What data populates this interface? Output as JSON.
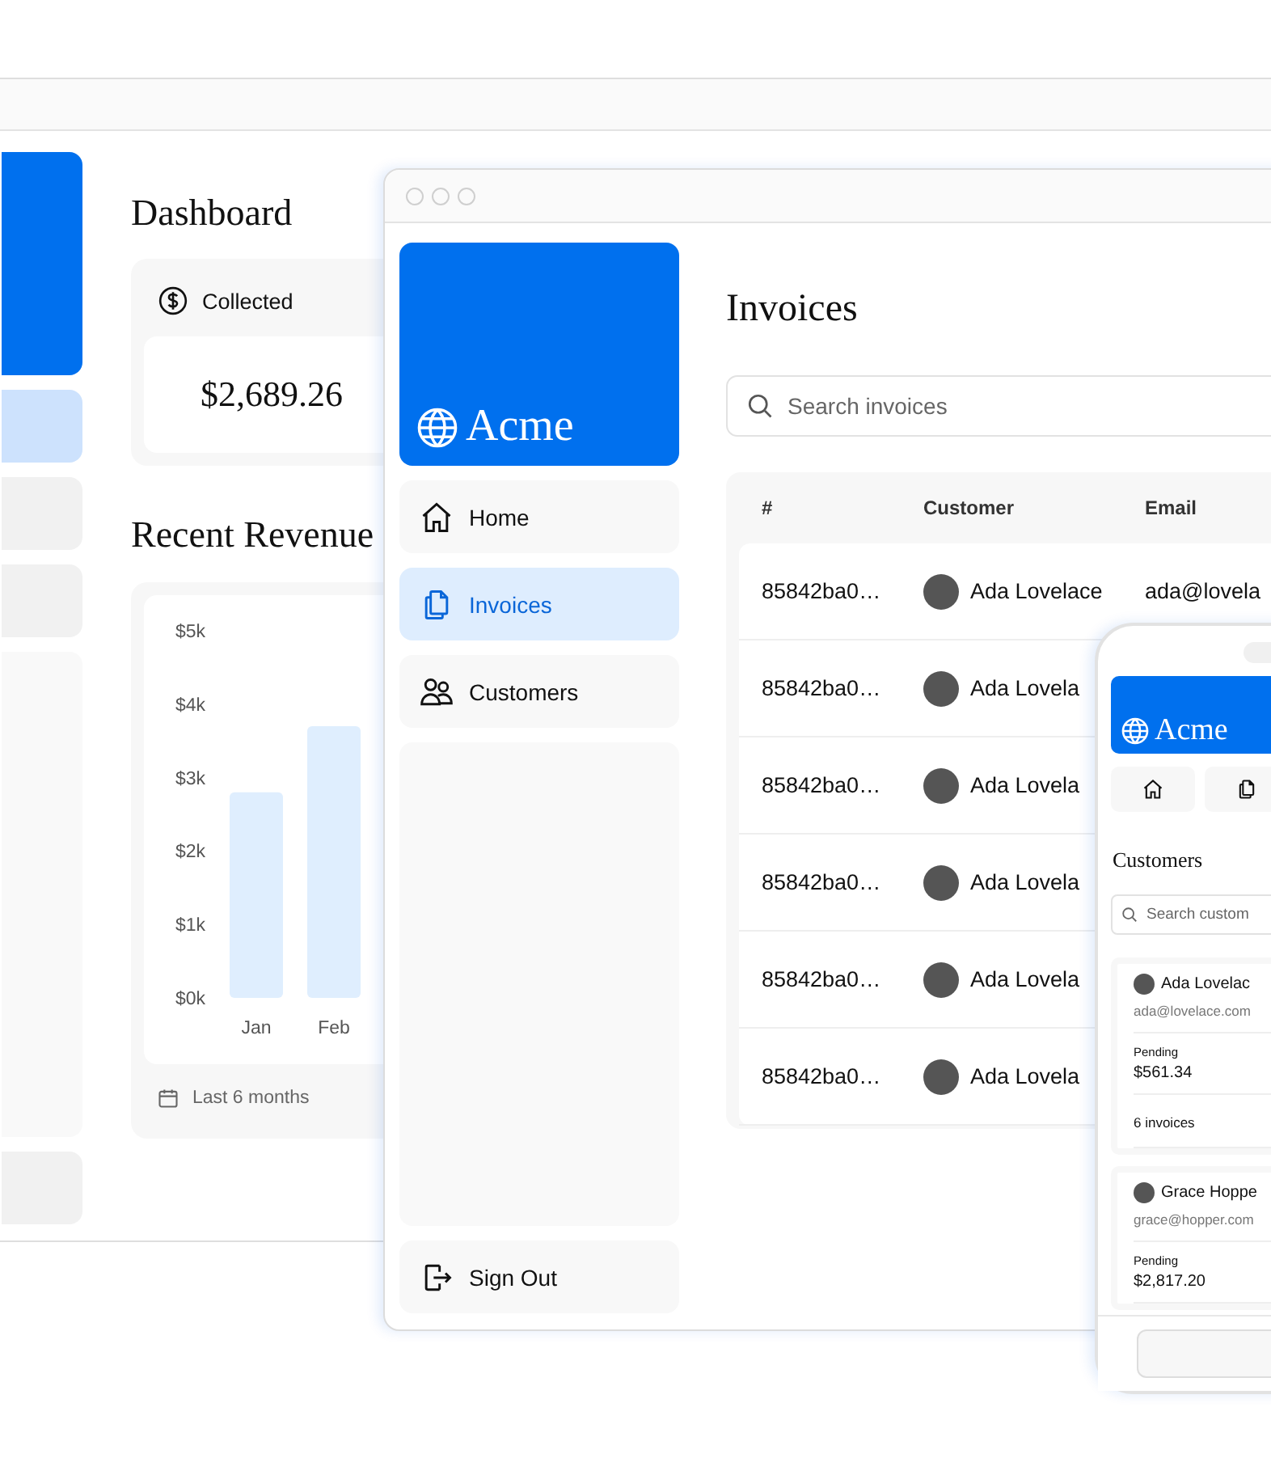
{
  "back_window": {
    "nav": [
      {
        "selected": true
      },
      {
        "selected": false
      },
      {
        "selected": false
      }
    ]
  },
  "dashboard": {
    "title": "Dashboard",
    "card": {
      "label": "Collected",
      "value": "$2,689.26"
    },
    "revenue_title": "Recent Revenue",
    "chart_data": {
      "type": "bar",
      "categories": [
        "Jan",
        "Feb"
      ],
      "values": [
        2800,
        3700
      ],
      "ylim": [
        0,
        5000
      ],
      "yticks": [
        {
          "value": 0,
          "label": "$0k"
        },
        {
          "value": 1000,
          "label": "$1k"
        },
        {
          "value": 2000,
          "label": "$2k"
        },
        {
          "value": 3000,
          "label": "$3k"
        },
        {
          "value": 4000,
          "label": "$4k"
        },
        {
          "value": 5000,
          "label": "$5k"
        }
      ]
    },
    "footer": "Last 6 months"
  },
  "invoices_window": {
    "brand": "Acme",
    "nav": [
      {
        "label": "Home",
        "kind": "home",
        "selected": false
      },
      {
        "label": "Invoices",
        "kind": "document",
        "selected": true
      },
      {
        "label": "Customers",
        "kind": "users",
        "selected": false
      }
    ],
    "sign_out": "Sign Out",
    "title": "Invoices",
    "search": {
      "placeholder": "Search invoices"
    },
    "table": {
      "columns": [
        "#",
        "Customer",
        "Email"
      ],
      "rows": [
        {
          "id": "85842ba0…",
          "customer": "Ada Lovelace",
          "email": "ada@lovela"
        },
        {
          "id": "85842ba0…",
          "customer": "Ada Lovela"
        },
        {
          "id": "85842ba0…",
          "customer": "Ada Lovela"
        },
        {
          "id": "85842ba0…",
          "customer": "Ada Lovela"
        },
        {
          "id": "85842ba0…",
          "customer": "Ada Lovela"
        },
        {
          "id": "85842ba0…",
          "customer": "Ada Lovela"
        }
      ]
    }
  },
  "phone": {
    "brand": "Acme",
    "nav": [
      {
        "kind": "home"
      },
      {
        "kind": "document"
      }
    ],
    "title": "Customers",
    "search": {
      "placeholder": "Search custom"
    },
    "customers": [
      {
        "name": "Ada Lovelac",
        "email": "ada@lovelace.com",
        "pending_label": "Pending",
        "pending": "$561.34",
        "invoices": "6 invoices"
      },
      {
        "name": "Grace Hoppe",
        "email": "grace@hopper.com",
        "pending_label": "Pending",
        "pending": "$2,817.20"
      }
    ]
  }
}
